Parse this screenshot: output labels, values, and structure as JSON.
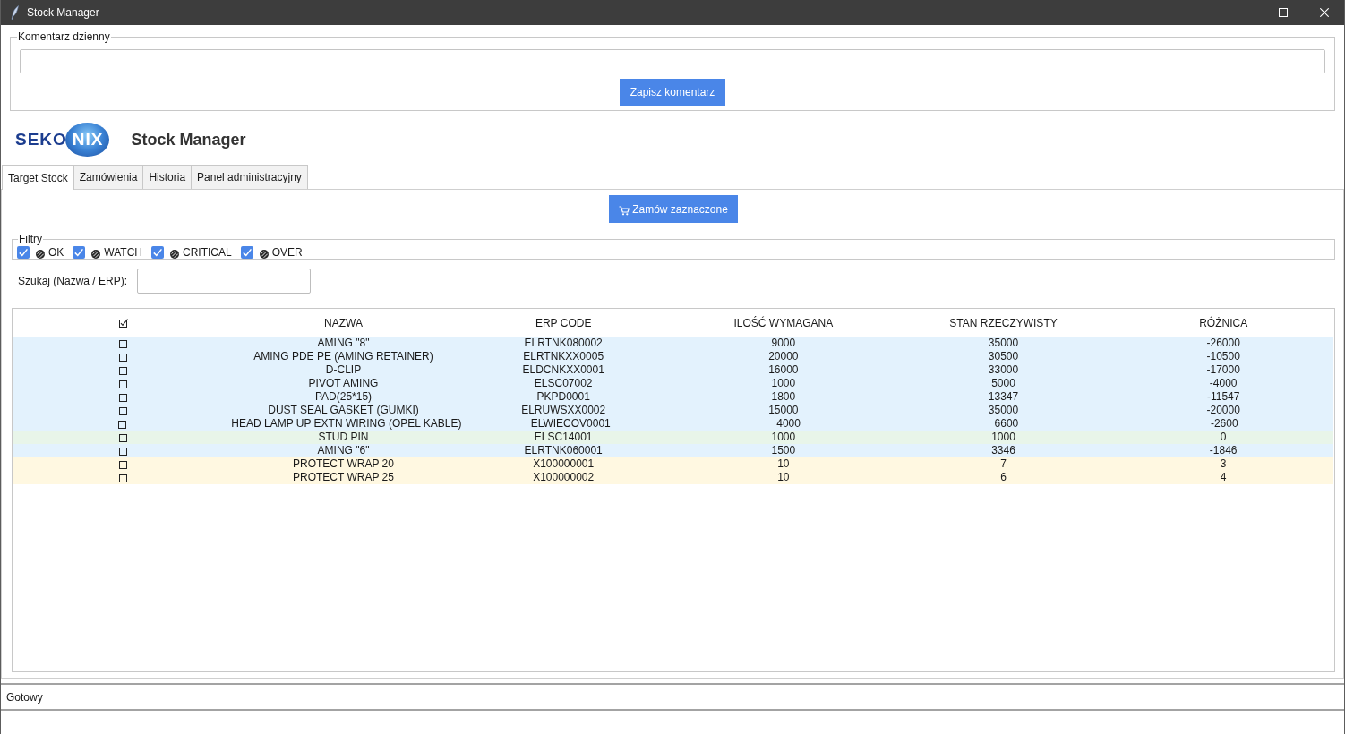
{
  "window": {
    "title": "Stock Manager"
  },
  "comment_panel": {
    "label": "Komentarz dzienny",
    "button": "Zapisz komentarz"
  },
  "header": {
    "logo": {
      "left": "SEKO",
      "right": "NIX"
    },
    "title": "Stock Manager"
  },
  "tabs": [
    {
      "label": "Target Stock",
      "selected": true
    },
    {
      "label": "Zamówienia",
      "selected": false
    },
    {
      "label": "Historia",
      "selected": false
    },
    {
      "label": "Panel administracyjny",
      "selected": false
    }
  ],
  "order_button": "Zamów zaznaczone",
  "filters": {
    "label": "Filtry",
    "items": [
      {
        "label": "OK",
        "checked": true
      },
      {
        "label": "WATCH",
        "checked": true
      },
      {
        "label": "CRITICAL",
        "checked": true
      },
      {
        "label": "OVER",
        "checked": true
      }
    ]
  },
  "search": {
    "label": "Szukaj (Nazwa / ERP):"
  },
  "table": {
    "select_all": {
      "checked": true
    },
    "columns": [
      "NAZWA",
      "ERP CODE",
      "ILOŚĆ WYMAGANA",
      "STAN RZECZYWISTY",
      "RÓŻNICA"
    ],
    "rows": [
      {
        "checked": false,
        "color": "#e3f2fd",
        "cells": [
          "AMING \"8\"",
          "ELRTNK080002",
          "9000",
          "35000",
          "-26000"
        ]
      },
      {
        "checked": false,
        "color": "#e3f2fd",
        "cells": [
          "AMING PDE PE (AMING RETAINER)",
          "ELRTNKXX0005",
          "20000",
          "30500",
          "-10500"
        ]
      },
      {
        "checked": false,
        "color": "#e3f2fd",
        "cells": [
          "D-CLIP",
          "ELDCNKXX0001",
          "16000",
          "33000",
          "-17000"
        ]
      },
      {
        "checked": false,
        "color": "#e3f2fd",
        "cells": [
          "PIVOT AMING",
          "ELSC07002",
          "1000",
          "5000",
          "-4000"
        ]
      },
      {
        "checked": false,
        "color": "#e3f2fd",
        "cells": [
          "PAD(25*15)",
          "PKPD0001",
          "1800",
          "13347",
          "-11547"
        ]
      },
      {
        "checked": false,
        "color": "#e3f2fd",
        "cells": [
          "DUST SEAL GASKET (GUMKI)",
          "ELRUWSXX0002",
          "15000",
          "35000",
          "-20000"
        ]
      },
      {
        "checked": false,
        "color": "#e3f2fd",
        "cells": [
          "HEAD LAMP UP EXTN WIRING (OPEL KABLE)",
          "ELWIECOV0001",
          "4000",
          "6600",
          "-2600"
        ]
      },
      {
        "checked": false,
        "color": "#e8f5e9",
        "cells": [
          "STUD PIN",
          "ELSC14001",
          "1000",
          "1000",
          "0"
        ]
      },
      {
        "checked": false,
        "color": "#e3f2fd",
        "cells": [
          "AMING \"6\"",
          "ELRTNK060001",
          "1500",
          "3346",
          "-1846"
        ]
      },
      {
        "checked": false,
        "color": "#fff8e1",
        "cells": [
          "PROTECT WRAP 20",
          "X100000001",
          "10",
          "7",
          "3"
        ]
      },
      {
        "checked": false,
        "color": "#fff8e1",
        "cells": [
          "PROTECT WRAP 25",
          "X100000002",
          "10",
          "6",
          "4"
        ]
      }
    ]
  },
  "status_bar": {
    "text": "Gotowy"
  }
}
